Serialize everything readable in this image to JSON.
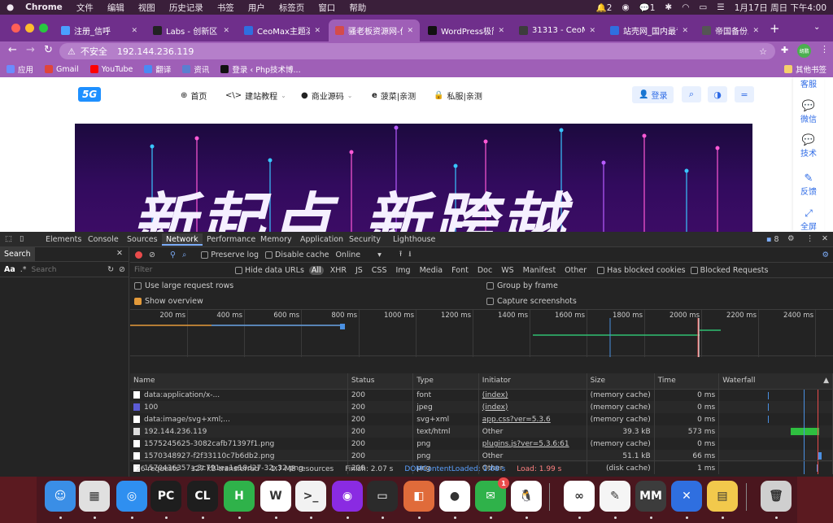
{
  "menubar": {
    "app_name": "Chrome",
    "menus": [
      "文件",
      "编辑",
      "视图",
      "历史记录",
      "书签",
      "用户",
      "标签页",
      "窗口",
      "帮助"
    ],
    "wechat_count": "1",
    "notification_count": "2",
    "clock": "1月17日 周日 下午4:00"
  },
  "tabs": [
    {
      "label": "注册_信呼",
      "color": "#4aa0ff"
    },
    {
      "label": "Labs - 创新区",
      "color": "#222222"
    },
    {
      "label": "CeoMax主题演示",
      "color": "#2f6fe0"
    },
    {
      "label": "骚老板资源网-优",
      "color": "#d44b4b",
      "active": true
    },
    {
      "label": "WordPress极简",
      "color": "#111111"
    },
    {
      "label": "31313 - CeoMax",
      "color": "#3c3c3c"
    },
    {
      "label": "站壳网_国内最专",
      "color": "#2f6fe0"
    },
    {
      "label": "帝国备份王、EB",
      "color": "#555555"
    }
  ],
  "toolbar": {
    "insecure_label": "不安全",
    "url": "192.144.236.119",
    "profile_initials": "胡鹏"
  },
  "bookmarks": [
    {
      "label": "应用",
      "color": "#6b8cff"
    },
    {
      "label": "Gmail",
      "color": "#e0453a"
    },
    {
      "label": "YouTube",
      "color": "#ff0000"
    },
    {
      "label": "翻译",
      "color": "#4a8af4"
    },
    {
      "label": "资讯",
      "color": "#5a7fd0"
    },
    {
      "label": "登录 ‹ Php技术博...",
      "color": "#111111"
    }
  ],
  "other_bookmarks": "其他书签",
  "site": {
    "logo": "5G",
    "nav": [
      "首页",
      "建站教程",
      "商业源码",
      "菠菜|亲测",
      "私服|亲测"
    ],
    "login": "登录",
    "hero_text": "新起点 新跨越",
    "side_items": [
      "客服",
      "微信",
      "技术",
      "反馈",
      "全屏"
    ]
  },
  "devtools": {
    "tabs": [
      "Elements",
      "Console",
      "Sources",
      "Network",
      "Performance",
      "Memory",
      "Application",
      "Security",
      "Lighthouse"
    ],
    "active_tab": "Network",
    "issues_count": "8",
    "search_tab": "Search",
    "search_placeholder": "Search",
    "search_case": "Aa",
    "search_regex": ".*",
    "preserve_log": "Preserve log",
    "disable_cache": "Disable cache",
    "throttle": "Online",
    "filter_placeholder": "Filter",
    "hide_data_urls": "Hide data URLs",
    "type_filters": [
      "All",
      "XHR",
      "JS",
      "CSS",
      "Img",
      "Media",
      "Font",
      "Doc",
      "WS",
      "Manifest",
      "Other"
    ],
    "has_blocked_cookies": "Has blocked cookies",
    "blocked_requests": "Blocked Requests",
    "large_rows": "Use large request rows",
    "show_overview": "Show overview",
    "group_by_frame": "Group by frame",
    "capture_screenshots": "Capture screenshots",
    "timeline_ticks": [
      "200 ms",
      "400 ms",
      "600 ms",
      "800 ms",
      "1000 ms",
      "1200 ms",
      "1400 ms",
      "1600 ms",
      "1800 ms",
      "2000 ms",
      "2200 ms",
      "2400 ms"
    ],
    "columns": [
      "Name",
      "Status",
      "Type",
      "Initiator",
      "Size",
      "Time",
      "Waterfall"
    ],
    "requests": [
      {
        "name": "data:application/x-...",
        "status": "200",
        "type": "font",
        "initiator": "(index)",
        "size": "(memory cache)",
        "time": "0 ms",
        "icon": "#ffffff"
      },
      {
        "name": "100",
        "status": "200",
        "type": "jpeg",
        "initiator": "(index)",
        "size": "(memory cache)",
        "time": "0 ms",
        "icon": "#5b5bd6"
      },
      {
        "name": "data:image/svg+xml;...",
        "status": "200",
        "type": "svg+xml",
        "initiator": "app.css?ver=5.3.6",
        "size": "(memory cache)",
        "time": "0 ms",
        "icon": "#ffffff"
      },
      {
        "name": "192.144.236.119",
        "status": "200",
        "type": "text/html",
        "initiator": "Other",
        "size": "39.3 kB",
        "time": "573 ms",
        "icon": "#dddddd"
      },
      {
        "name": "1575245625-3082cafb71397f1.png",
        "status": "200",
        "type": "png",
        "initiator": "plugins.js?ver=5.3.6:61",
        "size": "(memory cache)",
        "time": "0 ms",
        "icon": "#ffffff"
      },
      {
        "name": "1570348927-f2f33110c7b6db2.png",
        "status": "200",
        "type": "png",
        "initiator": "Other",
        "size": "51.1 kB",
        "time": "66 ms",
        "icon": "#ffffff"
      },
      {
        "name": "1570436357-c3c791ea1e18d27-32x32.png",
        "status": "200",
        "type": "png",
        "initiator": "Other",
        "size": "(disk cache)",
        "time": "1 ms",
        "icon": "#ffffff"
      }
    ],
    "summary": {
      "requests": "26 requests",
      "transferred": "127 kB transferred",
      "resources": "1.7 MB resources",
      "finish": "Finish: 2.07 s",
      "dcl": "DOMContentLoaded: 1.68 s",
      "load": "Load: 1.99 s"
    }
  },
  "dock": [
    {
      "label": "Finder",
      "glyph": "☺",
      "color": "#3a8ee6"
    },
    {
      "label": "Launchpad",
      "glyph": "▦",
      "color": "#e0e0e0"
    },
    {
      "label": "Safari",
      "glyph": "◎",
      "color": "#2f8ff0"
    },
    {
      "label": "PyCharm",
      "glyph": "PC",
      "color": "#1e1e1e"
    },
    {
      "label": "CLion",
      "glyph": "CL",
      "color": "#1e1e1e"
    },
    {
      "label": "HBuilder",
      "glyph": "H",
      "color": "#2fb24a"
    },
    {
      "label": "Wenku",
      "glyph": "W",
      "color": "#ffffff"
    },
    {
      "label": "Messages",
      "glyph": ">_",
      "color": "#f2f2f2"
    },
    {
      "label": "Podcast",
      "glyph": "◉",
      "color": "#8a2be2"
    },
    {
      "label": "Terminal",
      "glyph": "▭",
      "color": "#2b2b2b"
    },
    {
      "label": "Sequel",
      "glyph": "◧",
      "color": "#e06b3a"
    },
    {
      "label": "Chrome",
      "glyph": "●",
      "color": "#ffffff"
    },
    {
      "label": "WeChat",
      "glyph": "✉",
      "color": "#2fb24a",
      "badge": "1"
    },
    {
      "label": "QQ",
      "glyph": "🐧",
      "color": "#ffffff"
    },
    {
      "label": "Baidu",
      "glyph": "∞",
      "color": "#ffffff"
    },
    {
      "label": "TextEdit",
      "glyph": "✎",
      "color": "#f5f5f5"
    },
    {
      "label": "MindMaster",
      "glyph": "MM",
      "color": "#3c3c3c"
    },
    {
      "label": "RemoteDesktop",
      "glyph": "✕",
      "color": "#2f6fe0"
    },
    {
      "label": "Archive",
      "glyph": "▤",
      "color": "#f2c94c"
    },
    {
      "label": "Trash",
      "glyph": "🗑",
      "color": "#cfcfcf"
    }
  ]
}
